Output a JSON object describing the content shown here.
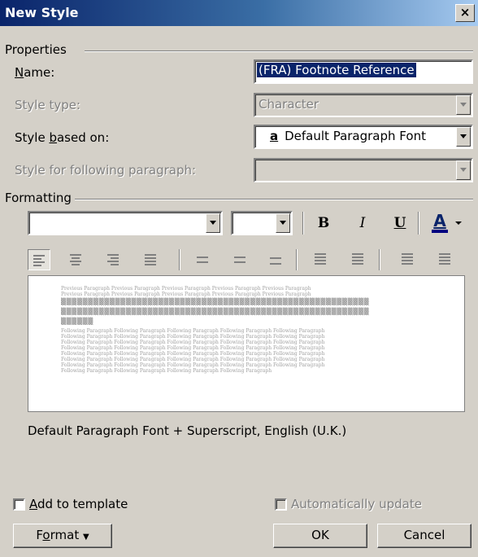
{
  "window": {
    "title": "New Style",
    "close_label": "×"
  },
  "properties": {
    "group_label": "Properties",
    "name_label": "Name:",
    "name_value": "(FRA) Footnote Reference",
    "style_type_label": "Style type:",
    "style_type_value": "Character",
    "based_on_label": "Style based on:",
    "based_on_icon": "a",
    "based_on_value": "Default Paragraph Font",
    "following_label": "Style for following paragraph:",
    "following_value": ""
  },
  "formatting": {
    "group_label": "Formatting",
    "font_value": "",
    "size_value": "",
    "bold": "B",
    "italic": "I",
    "underline": "U",
    "font_color": "A",
    "font_color_swatch": "#000080"
  },
  "preview": {
    "previous_lines": [
      "Previous Paragraph Previous Paragraph Previous Paragraph Previous Paragraph Previous Paragraph",
      "Previous Paragraph Previous Paragraph Previous Paragraph Previous Paragraph Previous Paragraph"
    ],
    "sample_lines": [
      "▒▒▒▒▒▒▒▒▒▒▒▒▒▒▒▒▒▒▒▒▒▒▒▒▒▒▒▒▒▒▒▒▒▒▒▒▒▒▒▒▒▒▒▒▒▒▒▒▒▒▒▒▒▒▒▒▒",
      "▒▒▒▒▒▒▒▒▒▒▒▒▒▒▒▒▒▒▒▒▒▒▒▒▒▒▒▒▒▒▒▒▒▒▒▒▒▒▒▒▒▒▒▒▒▒▒▒▒▒▒▒▒▒▒▒▒",
      "▒▒▒▒▒▒"
    ],
    "following_lines": [
      "Following Paragraph Following Paragraph Following Paragraph Following Paragraph Following Paragraph",
      "Following Paragraph Following Paragraph Following Paragraph Following Paragraph Following Paragraph",
      "Following Paragraph Following Paragraph Following Paragraph Following Paragraph Following Paragraph",
      "Following Paragraph Following Paragraph Following Paragraph Following Paragraph Following Paragraph",
      "Following Paragraph Following Paragraph Following Paragraph Following Paragraph Following Paragraph",
      "Following Paragraph Following Paragraph Following Paragraph Following Paragraph Following Paragraph",
      "Following Paragraph Following Paragraph Following Paragraph Following Paragraph Following Paragraph",
      "Following Paragraph Following Paragraph Following Paragraph Following Paragraph"
    ]
  },
  "description": "Default Paragraph Font + Superscript, English (U.K.)",
  "options": {
    "add_to_template_label": "Add to template",
    "auto_update_label": "Automatically update"
  },
  "buttons": {
    "format": "Format",
    "ok": "OK",
    "cancel": "Cancel"
  }
}
